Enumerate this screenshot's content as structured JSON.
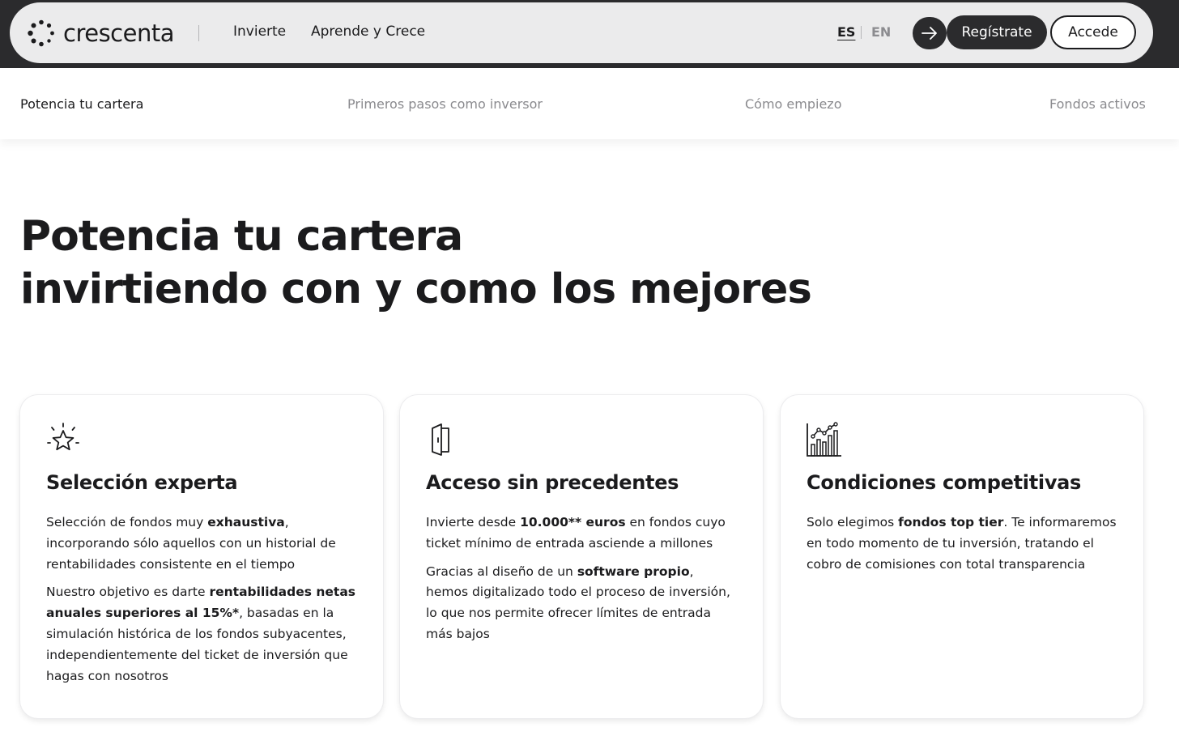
{
  "brand": {
    "name": "crescenta"
  },
  "nav": {
    "links": [
      "Invierte",
      "Aprende y Crece"
    ],
    "lang_es": "ES",
    "lang_en": "EN",
    "register_label": "Regístrate",
    "login_label": "Accede"
  },
  "subnav": {
    "items": [
      "Potencia tu cartera",
      "Primeros pasos como inversor",
      "Cómo empiezo",
      "Fondos activos"
    ]
  },
  "hero": {
    "title": "Potencia tu cartera",
    "subtitle": "invirtiendo con y como los mejores"
  },
  "cards": [
    {
      "icon": "star-icon",
      "title": "Selección experta",
      "p1": {
        "a": "Selección de fondos muy ",
        "b": "exhaustiva",
        "c": ", incorporando sólo aquellos con un historial de rentabilidades consistente en el tiempo"
      },
      "p2": {
        "a": "Nuestro objetivo es darte ",
        "b": "rentabilidades netas anuales superiores al 15%*",
        "c": ", basadas en la simulación histórica de los fondos subyacentes, independientemente del ticket de inversión que hagas con nosotros"
      }
    },
    {
      "icon": "door-icon",
      "title": "Acceso sin precedentes",
      "p1": {
        "a": "Invierte desde ",
        "b": "10.000** euros",
        "c": " en fondos cuyo ticket mínimo de entrada asciende a millones"
      },
      "p2": {
        "a": "Gracias al diseño de un ",
        "b": "software propio",
        "c": ", hemos digitalizado todo el proceso de inversión, lo que nos permite ofrecer límites de entrada más bajos"
      }
    },
    {
      "icon": "growth-chart-icon",
      "title": "Condiciones competitivas",
      "p1": {
        "a": "Solo elegimos ",
        "b": "fondos top tier",
        "c": ". Te informaremos en todo momento de tu inversión, tratando el cobro de comisiones con total transparencia"
      }
    }
  ]
}
